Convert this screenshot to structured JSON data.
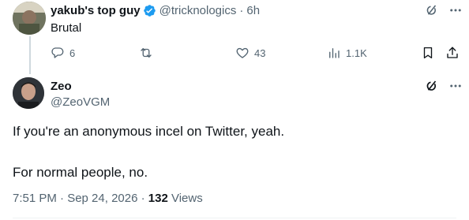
{
  "parent_tweet": {
    "display_name": "yakub's top guy",
    "handle": "@tricknologics",
    "separator": "·",
    "time": "6h",
    "text": "Brutal",
    "stats": {
      "replies": "6",
      "retweets": "",
      "likes": "43",
      "views": "1.1K"
    },
    "icons": [
      "grok-icon",
      "more-icon",
      "reply-icon",
      "retweet-icon",
      "like-icon",
      "views-icon",
      "bookmark-icon",
      "share-icon",
      "verified-badge-icon"
    ]
  },
  "reply_tweet": {
    "display_name": "Zeo",
    "handle": "@ZeoVGM",
    "paragraphs": [
      "If you're an anonymous incel on Twitter, yeah.",
      "For normal people, no."
    ],
    "timestamp": "7:51 PM · Sep 24, 2026 ·",
    "views_count": "132",
    "views_label": "Views"
  },
  "colors": {
    "text_primary": "#0f1419",
    "text_secondary": "#536471",
    "verified_blue": "#1d9bf0",
    "thread_line": "#cfd9de",
    "divider": "#eff3f4"
  }
}
